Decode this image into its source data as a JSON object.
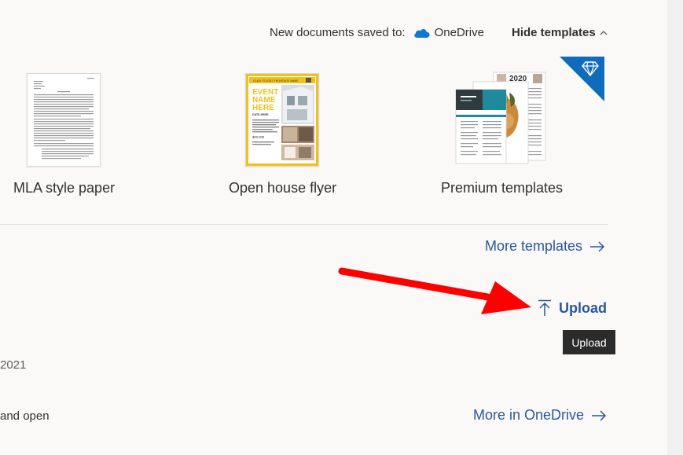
{
  "header": {
    "saved_to_label": "New documents saved to:",
    "onedrive_label": "OneDrive",
    "hide_templates_label": "Hide templates"
  },
  "templates": [
    {
      "label": "MLA style paper"
    },
    {
      "label": "Open house flyer"
    },
    {
      "label": "Premium templates",
      "badge_icon": "diamond-icon"
    }
  ],
  "flyer": {
    "banner": "CLICK TO EDIT FRONTAGE NAME",
    "headline": "EVENT NAME HERE",
    "date": "DATE HERE",
    "price": "$00,000"
  },
  "premium_thumb_year": "2020",
  "more_templates_label": "More templates",
  "upload": {
    "label": "Upload",
    "tooltip": "Upload"
  },
  "partial_text": {
    "year_fragment": "2021",
    "open_fragment": "and open"
  },
  "more_onedrive_label": "More in OneDrive",
  "colors": {
    "link": "#2b579a",
    "onedrive": "#0f78d4",
    "premium_badge": "#0f6cbd",
    "annotation_arrow": "#ff0000",
    "flyer_accent": "#f2c01a"
  }
}
